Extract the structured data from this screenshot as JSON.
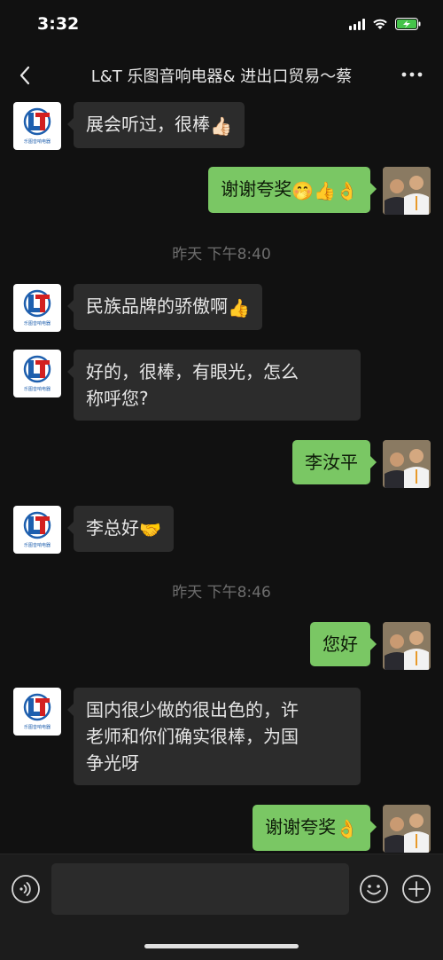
{
  "status_bar": {
    "time": "3:32"
  },
  "header": {
    "title": "L&T 乐图音响电器& 进出口贸易～蔡"
  },
  "messages": [
    {
      "side": "in",
      "text": "展会听过，很棒",
      "emoji": "👍🏻"
    },
    {
      "side": "out",
      "text": "谢谢夸奖",
      "emoji": "🤭👍👌"
    },
    {
      "side": "in",
      "text": "民族品牌的骄傲啊",
      "emoji": "👍"
    },
    {
      "side": "in",
      "line1": "好的，很棒，有眼光，怎么",
      "line2": "称呼您?"
    },
    {
      "side": "out",
      "text": "李汝平"
    },
    {
      "side": "in",
      "text": "李总好",
      "emoji": "🤝"
    },
    {
      "side": "out",
      "text": "您好"
    },
    {
      "side": "in",
      "line1": "国内很少做的很出色的，许",
      "line2": "老师和你们确实很棒，为国",
      "line3": "争光呀"
    },
    {
      "side": "out",
      "text": "谢谢夸奖",
      "emoji": "👌"
    }
  ],
  "timestamps": [
    "昨天 下午8:40",
    "昨天 下午8:46"
  ],
  "logo_text": "乐图音响电器",
  "icons": {
    "back": "chevron-left-icon",
    "more": "more-dots-icon",
    "voice": "voice-icon",
    "emoji": "smiley-icon",
    "plus": "plus-icon"
  },
  "colors": {
    "background": "#111111",
    "bubble_in": "#2c2c2c",
    "bubble_out": "#7ac764",
    "timestamp": "#6e6e6e"
  }
}
